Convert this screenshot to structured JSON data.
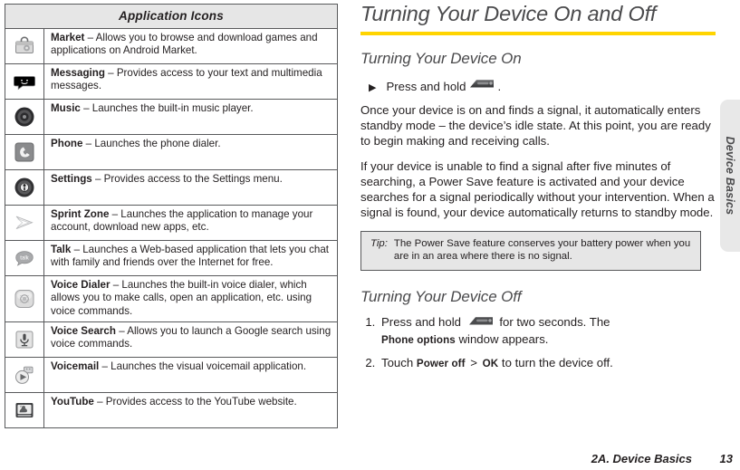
{
  "table": {
    "header": "Application Icons",
    "rows": [
      {
        "icon": "market-icon",
        "name": "Market",
        "dash": " – ",
        "desc": "Allows you to browse and download games and applications on Android Market."
      },
      {
        "icon": "messaging-icon",
        "name": "Messaging",
        "dash": " – ",
        "desc": "Provides access to your text and multimedia messages."
      },
      {
        "icon": "music-icon",
        "name": "Music",
        "dash": " – ",
        "desc": "Launches the built-in music player."
      },
      {
        "icon": "phone-icon",
        "name": "Phone",
        "dash": " – ",
        "desc": "Launches the phone dialer."
      },
      {
        "icon": "settings-icon",
        "name": "Settings",
        "dash": " – ",
        "desc": "Provides access to the Settings menu."
      },
      {
        "icon": "sprint-zone-icon",
        "name": "Sprint Zone",
        "dash": " – ",
        "desc": "Launches the application to manage your account, download new apps, etc."
      },
      {
        "icon": "talk-icon",
        "name": "Talk",
        "dash": " – ",
        "desc": "Launches a Web-based application that lets you chat with family and friends over the Internet for free."
      },
      {
        "icon": "voice-dialer-icon",
        "name": "Voice Dialer",
        "dash": " – ",
        "desc": "Launches the built-in voice dialer, which allows you to make calls, open an application, etc. using voice commands."
      },
      {
        "icon": "voice-search-icon",
        "name": "Voice Search",
        "dash": " – ",
        "desc": "Allows you to launch a Google search using voice commands."
      },
      {
        "icon": "voicemail-icon",
        "name": "Voicemail",
        "dash": " – ",
        "desc": "Launches the visual voicemail application."
      },
      {
        "icon": "youtube-icon",
        "name": "YouTube",
        "dash": " – ",
        "desc": "Provides access to the YouTube website."
      }
    ]
  },
  "article": {
    "title": "Turning Your Device On and Off",
    "section_on": "Turning Your Device On",
    "bullet_press_hold": "Press and hold",
    "bullet_period": ".",
    "paragraph_1": "Once your device is on and finds a signal, it automatically enters standby mode – the device’s idle state. At this point, you are ready to begin making and receiving calls.",
    "paragraph_2": "If your device is unable to find a signal after five minutes of searching, a Power Save feature is activated and your device searches for a signal periodically without your intervention. When a signal is found, your device automatically returns to standby mode.",
    "tip_label": "Tip:",
    "tip_text": "The Power Save feature conserves your battery power when you are in an area where there is no signal.",
    "section_off": "Turning Your Device Off",
    "step1_pre": "Press and hold",
    "step1_mid": "for two seconds. The",
    "step1_bold": "Phone options",
    "step1_post": "window appears.",
    "step2_pre": "Touch",
    "step2_bold1": "Power off",
    "step2_sep": ">",
    "step2_bold2": "OK",
    "step2_post": "to turn the device off."
  },
  "sidebar_tab": {
    "label": "Device Basics"
  },
  "footer": {
    "chapter": "2A. Device Basics",
    "page": "13"
  },
  "colors": {
    "accent_yellow": "#ffd400",
    "heading_gray": "#4a4a4c",
    "rule_gray": "#58595b",
    "tip_bg": "#e6e6e6",
    "tab_bg": "#e8e8e8",
    "body_text": "#231f20"
  },
  "icon_glyphs": {
    "power-key-icon": "power-button-key"
  }
}
